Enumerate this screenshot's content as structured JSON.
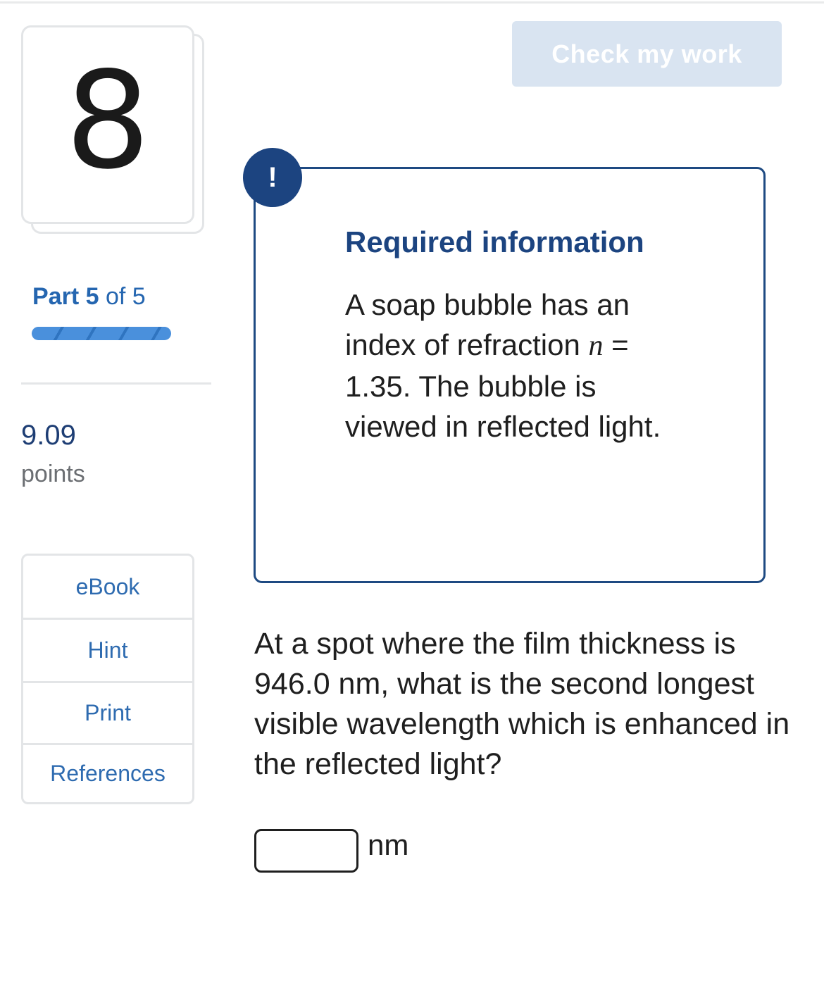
{
  "question": {
    "number": "8",
    "part_label": "Part",
    "part_current": "5",
    "part_of": "of 5",
    "progress_fraction": 1.0,
    "points_value": "9.09",
    "points_label": "points"
  },
  "resources": [
    "eBook",
    "Hint",
    "Print",
    "References"
  ],
  "toolbar": {
    "check_label": "Check my work"
  },
  "info": {
    "alert_symbol": "!",
    "title": "Required information",
    "text_before_var": "A soap bubble has an index of refraction ",
    "var": "n",
    "text_after_var": " = 1.35. The bubble is viewed in reflected light."
  },
  "prompt": {
    "text": "At a spot where the film thickness is 946.0 nm, what is the second longest visible wavelength which is enhanced in the reflected light?",
    "answer_value": "",
    "unit": "nm"
  },
  "colors": {
    "accent_blue": "#2566b0",
    "navy": "#1c4480",
    "check_button_disabled": "#d9e4f1",
    "progress": "#3f8ad9"
  },
  "icons": {
    "alert": "exclamation-icon"
  }
}
